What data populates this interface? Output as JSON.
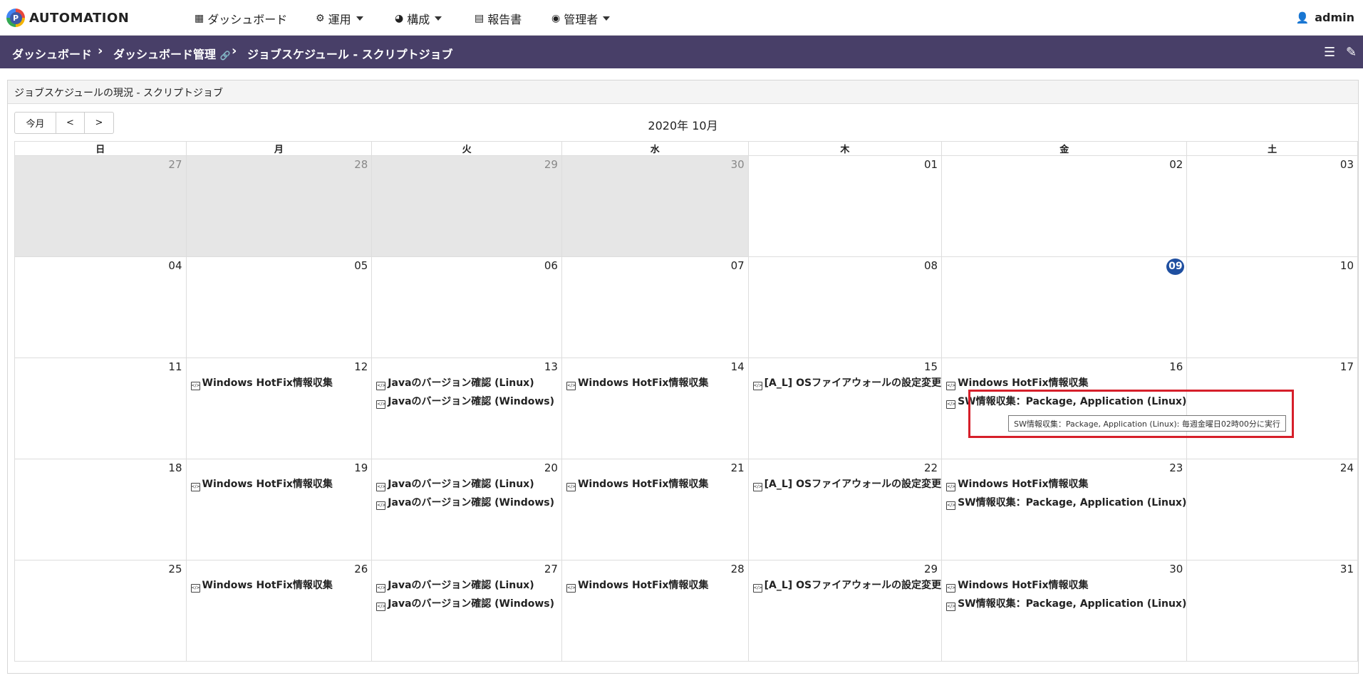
{
  "brand": {
    "logo_letter": "P",
    "name": "AUTOMATION"
  },
  "nav": {
    "dashboard": "ダッシュボード",
    "operation": "運用",
    "configuration": "構成",
    "reports": "報告書",
    "admin": "管理者",
    "user": "admin"
  },
  "breadcrumb": {
    "items": [
      "ダッシュボード",
      "ダッシュボード管理",
      "ジョブスケジュール - スクリプトジョブ"
    ]
  },
  "panel": {
    "title": "ジョブスケジュールの現況 - スクリプトジョブ"
  },
  "calendar": {
    "buttons": {
      "today": "今月",
      "prev": "<",
      "next": ">"
    },
    "month_title": "2020年 10月",
    "weekdays": [
      "日",
      "月",
      "火",
      "水",
      "木",
      "金",
      "土"
    ],
    "today": "09",
    "weeks": [
      [
        {
          "d": "27",
          "other": true,
          "events": []
        },
        {
          "d": "28",
          "other": true,
          "events": []
        },
        {
          "d": "29",
          "other": true,
          "events": []
        },
        {
          "d": "30",
          "other": true,
          "events": []
        },
        {
          "d": "01",
          "events": []
        },
        {
          "d": "02",
          "events": []
        },
        {
          "d": "03",
          "events": []
        }
      ],
      [
        {
          "d": "04",
          "events": []
        },
        {
          "d": "05",
          "events": []
        },
        {
          "d": "06",
          "events": []
        },
        {
          "d": "07",
          "events": []
        },
        {
          "d": "08",
          "events": []
        },
        {
          "d": "09",
          "today": true,
          "events": []
        },
        {
          "d": "10",
          "events": []
        }
      ],
      [
        {
          "d": "11",
          "events": []
        },
        {
          "d": "12",
          "events": [
            "Windows HotFix情報収集"
          ]
        },
        {
          "d": "13",
          "events": [
            "Javaのバージョン確認 (Linux)",
            "Javaのバージョン確認 (Windows)"
          ]
        },
        {
          "d": "14",
          "events": [
            "Windows HotFix情報収集"
          ]
        },
        {
          "d": "15",
          "events": [
            "[A_L] OSファイアウォールの設定変更"
          ]
        },
        {
          "d": "16",
          "events": [
            "Windows HotFix情報収集",
            "SW情報収集：Package, Application (Linux)"
          ]
        },
        {
          "d": "17",
          "events": []
        }
      ],
      [
        {
          "d": "18",
          "events": []
        },
        {
          "d": "19",
          "events": [
            "Windows HotFix情報収集"
          ]
        },
        {
          "d": "20",
          "events": [
            "Javaのバージョン確認 (Linux)",
            "Javaのバージョン確認 (Windows)"
          ]
        },
        {
          "d": "21",
          "events": [
            "Windows HotFix情報収集"
          ]
        },
        {
          "d": "22",
          "events": [
            "[A_L] OSファイアウォールの設定変更"
          ]
        },
        {
          "d": "23",
          "events": [
            "Windows HotFix情報収集",
            "SW情報収集：Package, Application (Linux)"
          ]
        },
        {
          "d": "24",
          "events": []
        }
      ],
      [
        {
          "d": "25",
          "events": []
        },
        {
          "d": "26",
          "events": [
            "Windows HotFix情報収集"
          ]
        },
        {
          "d": "27",
          "events": [
            "Javaのバージョン確認 (Linux)",
            "Javaのバージョン確認 (Windows)"
          ]
        },
        {
          "d": "28",
          "events": [
            "Windows HotFix情報収集"
          ]
        },
        {
          "d": "29",
          "events": [
            "[A_L] OSファイアウォールの設定変更"
          ]
        },
        {
          "d": "30",
          "events": [
            "Windows HotFix情報収集",
            "SW情報収集：Package, Application (Linux)"
          ]
        },
        {
          "d": "31",
          "events": []
        }
      ]
    ],
    "tooltip": "SW情報収集：Package, Application (Linux): 毎週金曜日02時00分に実行"
  },
  "icons": {
    "dashboard": "grid-icon",
    "operation": "gear-icon",
    "configuration": "pie-chart-icon",
    "reports": "document-icon",
    "admin": "user-circle-icon",
    "user": "user-icon",
    "event": "code-file-icon"
  },
  "colors": {
    "crumb_bar": "#483f68",
    "today_badge": "#1f4fa0",
    "highlight": "#d61f2a",
    "other_month": "#e6e6e6"
  }
}
